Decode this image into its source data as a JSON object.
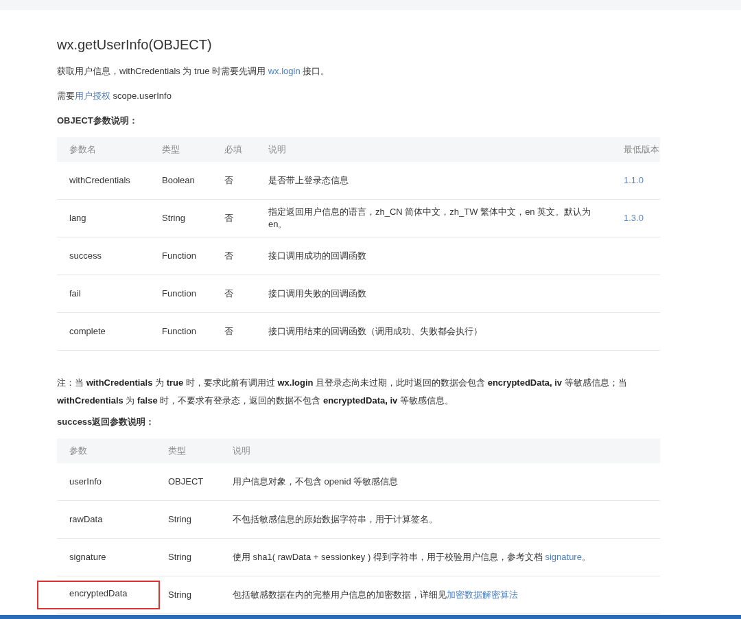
{
  "title": "wx.getUserInfo(OBJECT)",
  "intro": [
    {
      "text": "获取用户信息，withCredentials 为 true 时需要先调用 ",
      "link": false
    },
    {
      "text": "wx.login",
      "link": true
    },
    {
      "text": " 接口。",
      "link": false
    }
  ],
  "scope": [
    {
      "text": "需要",
      "link": false
    },
    {
      "text": "用户授权",
      "link": true
    },
    {
      "text": " scope.userInfo",
      "link": false
    }
  ],
  "object_heading": "OBJECT参数说明：",
  "object_table": {
    "columns": [
      "参数名",
      "类型",
      "必填",
      "说明",
      "最低版本"
    ],
    "rows": [
      {
        "name": "withCredentials",
        "type": "Boolean",
        "required": "否",
        "desc": "是否带上登录态信息",
        "version": "1.1.0"
      },
      {
        "name": "lang",
        "type": "String",
        "required": "否",
        "desc": "指定返回用户信息的语言，zh_CN 简体中文，zh_TW 繁体中文，en 英文。默认为en。",
        "version": "1.3.0"
      },
      {
        "name": "success",
        "type": "Function",
        "required": "否",
        "desc": "接口调用成功的回调函数"
      },
      {
        "name": "fail",
        "type": "Function",
        "required": "否",
        "desc": "接口调用失败的回调函数"
      },
      {
        "name": "complete",
        "type": "Function",
        "required": "否",
        "desc": "接口调用结束的回调函数（调用成功、失败都会执行）"
      }
    ]
  },
  "note": "注：当 **withCredentials** 为 **true** 时，要求此前有调用过 **wx.login** 且登录态尚未过期，此时返回的数据会包含 **encryptedData, iv** 等敏感信息；当 **withCredentials** 为 **false** 时，不要求有登录态，返回的数据不包含 **encryptedData, iv** 等敏感信息。",
  "success_heading": "success返回参数说明：",
  "success_table": {
    "columns": [
      "参数",
      "类型",
      "说明"
    ],
    "rows": [
      {
        "name": "userInfo",
        "type": "OBJECT",
        "desc": [
          {
            "text": "用户信息对象，不包含 openid 等敏感信息",
            "link": false
          }
        ],
        "highlighted": false
      },
      {
        "name": "rawData",
        "type": "String",
        "desc": [
          {
            "text": "不包括敏感信息的原始数据字符串，用于计算签名。",
            "link": false
          }
        ],
        "highlighted": false
      },
      {
        "name": "signature",
        "type": "String",
        "desc": [
          {
            "text": "使用 sha1( rawData + sessionkey ) 得到字符串，用于校验用户信息，参考文档 ",
            "link": false
          },
          {
            "text": "signature",
            "link": true
          },
          {
            "text": "。",
            "link": false
          }
        ],
        "highlighted": false
      },
      {
        "name": "encryptedData",
        "type": "String",
        "desc": [
          {
            "text": "包括敏感数据在内的完整用户信息的加密数据，详细见",
            "link": false
          },
          {
            "text": "加密数据解密算法",
            "link": true
          }
        ],
        "highlighted": true
      }
    ]
  }
}
